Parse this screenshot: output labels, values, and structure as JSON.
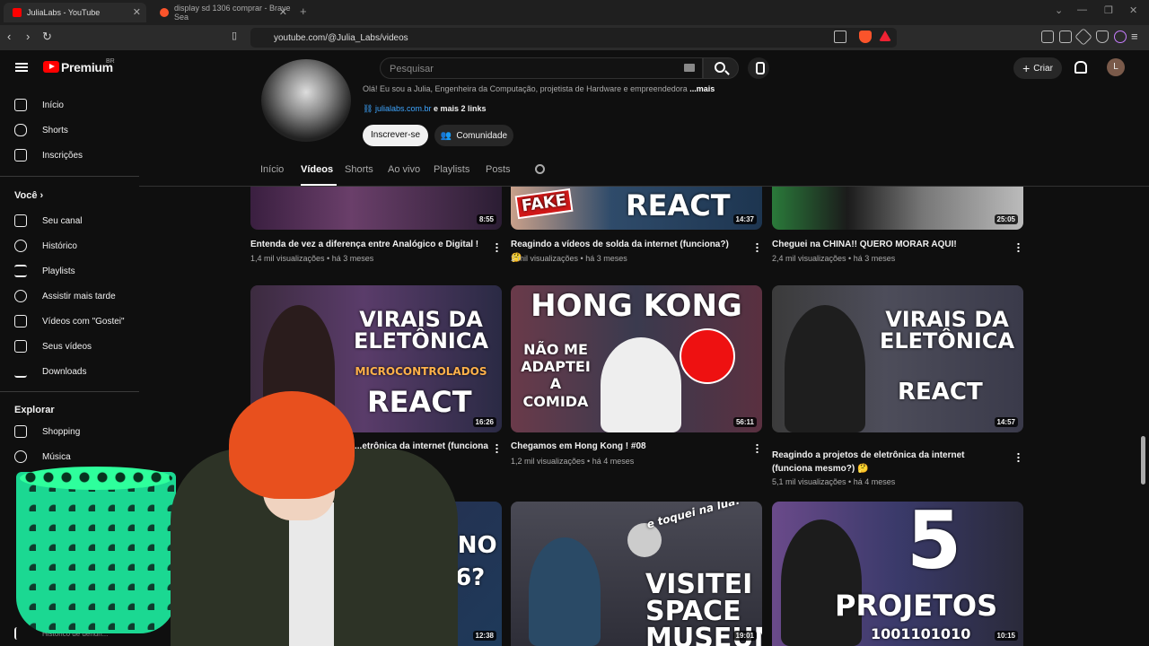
{
  "browser": {
    "tabs": [
      {
        "title": "JuliaLabs - YouTube",
        "active": true
      },
      {
        "title": "display sd 1306 comprar - Brave Sea",
        "active": false
      }
    ],
    "url": "youtube.com/@Julia_Labs/videos"
  },
  "header": {
    "brand": "Premium",
    "brand_region": "BR",
    "search_placeholder": "Pesquisar",
    "create_label": "Criar",
    "avatar_letter": "L"
  },
  "sidebar": {
    "main": [
      {
        "label": "Início",
        "icon": "home-icon"
      },
      {
        "label": "Shorts",
        "icon": "shorts-icon"
      },
      {
        "label": "Inscrições",
        "icon": "subscriptions-icon"
      }
    ],
    "you_heading": "Você",
    "you": [
      {
        "label": "Seu canal",
        "icon": "channel-icon"
      },
      {
        "label": "Histórico",
        "icon": "history-icon"
      },
      {
        "label": "Playlists",
        "icon": "playlists-icon"
      },
      {
        "label": "Assistir mais tarde",
        "icon": "watch-later-icon"
      },
      {
        "label": "Vídeos com \"Gostei\"",
        "icon": "like-icon"
      },
      {
        "label": "Seus vídeos",
        "icon": "your-videos-icon"
      },
      {
        "label": "Downloads",
        "icon": "download-icon"
      }
    ],
    "explore_heading": "Explorar",
    "explore": [
      {
        "label": "Shopping",
        "icon": "shopping-icon"
      },
      {
        "label": "Música",
        "icon": "music-icon"
      }
    ],
    "report_history": "Histórico de denún..."
  },
  "channel": {
    "description": "Olá! Eu sou a Julia, Engenheira da Computação, projetista de Hardware e empreendedora",
    "more": "...mais",
    "link": "julialabs.com.br",
    "more_links": "e mais 2 links",
    "subscribe": "Inscrever-se",
    "community": "Comunidade",
    "tabs": [
      "Início",
      "Vídeos",
      "Shorts",
      "Ao vivo",
      "Playlists",
      "Posts"
    ],
    "active_tab": "Vídeos"
  },
  "videos": [
    {
      "title": "Entenda de vez a diferença entre Analógico e Digital !",
      "views": "1,4 mil visualizações",
      "age": "há 3 meses",
      "duration": "8:55",
      "thumb_text": ""
    },
    {
      "title": "Reagindo a vídeos de solda da internet (funciona?) 🤔",
      "views": "2 mil visualizações",
      "age": "há 3 meses",
      "duration": "14:37",
      "thumb_text": "REACT",
      "badge": "FAKE"
    },
    {
      "title": "Cheguei na CHINA!! QUERO MORAR AQUI!",
      "views": "2,4 mil visualizações",
      "age": "há 3 meses",
      "duration": "25:05",
      "thumb_text": ""
    },
    {
      "title": "...etrônica da internet (funciona",
      "views": "",
      "age": "",
      "duration": "16:26",
      "thumb_text": "VIRAIS DA ELETÔNICA",
      "thumb_sub": "MICROCONTROLADOS",
      "thumb_text2": "REACT"
    },
    {
      "title": "Chegamos em Hong Kong ! #08",
      "views": "1,2 mil visualizações",
      "age": "há 4 meses",
      "duration": "56:11",
      "thumb_text": "HONG KONG",
      "thumb_sub": "NÃO ME ADAPTEI A COMIDA"
    },
    {
      "title": "Reagindo a projetos de eletrônica da internet (funciona mesmo?) 🤔",
      "views": "5,1 mil visualizações",
      "age": "há 4 meses",
      "duration": "14:57",
      "thumb_text": "VIRAIS DA ELETÔNICA",
      "thumb_text2": "REACT"
    },
    {
      "title": "",
      "views": "",
      "age": "",
      "duration": "12:38",
      "thumb_text": "UINO",
      "thumb_sub": "26?"
    },
    {
      "title": "",
      "views": "",
      "age": "",
      "duration": "19:01",
      "thumb_text": "VISITEI SPACE MUSEUM",
      "thumb_sub": "e toquei na lua!"
    },
    {
      "title": "",
      "views": "",
      "age": "",
      "duration": "10:15",
      "thumb_text": "5",
      "thumb_sub": "PROJETOS",
      "thumb_text2": "1001101010"
    }
  ],
  "colors": {
    "background": "#0f0f0f",
    "brand_red": "#ff0000",
    "link": "#3ea6ff"
  }
}
